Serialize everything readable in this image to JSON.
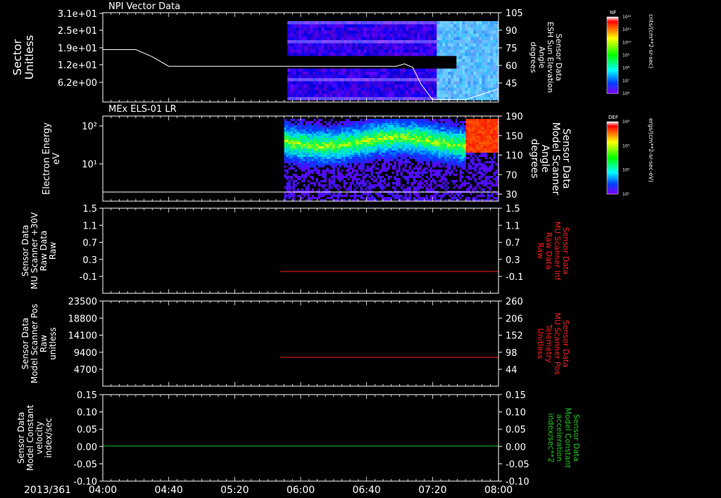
{
  "colors": {
    "background": "#000000",
    "axis": "#ffffff",
    "trace_white": "#ffffff",
    "trace_red": "#ff2020",
    "trace_green": "#20c820"
  },
  "time_axis": {
    "date_label": "2013/361",
    "ticks": [
      "04:00",
      "04:40",
      "05:20",
      "06:00",
      "06:40",
      "07:20",
      "08:00"
    ],
    "range": [
      "04:00",
      "08:00"
    ]
  },
  "colorbars": [
    {
      "label": "NF",
      "units": "cnts/(cm**2-sr-sec)",
      "ticks": [
        "10¹²",
        "10¹¹",
        "10¹⁰",
        "10⁹",
        "10⁸",
        "10⁷",
        "10⁶"
      ]
    },
    {
      "label": "DEF",
      "units": "ergs/(cm**2-sr-sec-eV)",
      "ticks": [
        "10⁴",
        "10³",
        "10²",
        "10¹"
      ]
    }
  ],
  "chart_data": [
    {
      "type": "heatmap",
      "title": "NPI Vector Data",
      "ylabel": [
        "Sector",
        "Unitless"
      ],
      "yticks_left": [
        "3.1e+01",
        "2.5e+01",
        "1.9e+01",
        "1.2e+01",
        "6.2e+00"
      ],
      "ylabel_right": [
        "Sensor Data",
        "ESH Sun Elevation",
        "Angle",
        "degrees"
      ],
      "yticks_right": [
        "105",
        "90",
        "75",
        "60",
        "45"
      ],
      "ylim_right": [
        30,
        105
      ],
      "data_start": "05:52",
      "line_series": {
        "color": "white",
        "x": [
          "04:00",
          "04:20",
          "04:30",
          "04:40",
          "05:00",
          "05:30",
          "06:00",
          "06:30",
          "06:58",
          "07:03",
          "07:08",
          "07:13",
          "07:20",
          "07:40",
          "08:00"
        ],
        "y": [
          74,
          74,
          68,
          60,
          60,
          60,
          60,
          60,
          60,
          62,
          59,
          45,
          32,
          32,
          41
        ]
      }
    },
    {
      "type": "heatmap",
      "title": "MEx ELS-01 LR",
      "ylabel": [
        "Electron Energy",
        "eV"
      ],
      "yscale": "log",
      "yticks_left": [
        "10²",
        "10¹"
      ],
      "ylabel_right": [
        "Sensor Data",
        "Model Scanner",
        "Angle",
        "degrees"
      ],
      "yticks_right": [
        "190",
        "150",
        "110",
        "70",
        "30"
      ],
      "ylim_right": [
        10,
        190
      ],
      "data_start": "05:50",
      "line_series": {
        "color": "white",
        "x": [
          "04:00",
          "08:00"
        ],
        "y": [
          17,
          17
        ]
      }
    },
    {
      "type": "line",
      "ylabel": [
        "Sensor Data",
        "MU Scanner +30V",
        "Raw Data",
        "Raw"
      ],
      "yticks_left": [
        "1.5",
        "1.1",
        "0.7",
        "0.3",
        "-0.1"
      ],
      "ylim": [
        -0.3,
        1.5
      ],
      "ylabel_right": [
        "Sensor Data",
        "MU Scanner Inf",
        "Raw Data",
        "Raw"
      ],
      "yticks_right": [
        "1.5",
        "1.1",
        "0.7",
        "0.3",
        "-0.1"
      ],
      "series": [
        {
          "color": "red",
          "x": [
            "05:47",
            "08:00"
          ],
          "y": [
            0.05,
            0.05
          ]
        }
      ]
    },
    {
      "type": "line",
      "ylabel": [
        "Sensor Data",
        "Model Scanner Pos",
        "Raw",
        "unitless"
      ],
      "yticks_left": [
        "23500",
        "18800",
        "14100",
        "9400",
        "4700"
      ],
      "ylim": [
        0,
        23500
      ],
      "ylabel_right": [
        "Sensor Data",
        "MU Scanner Pos",
        "Telemetry",
        "Unitless"
      ],
      "yticks_right": [
        "260",
        "206",
        "152",
        "98",
        "44"
      ],
      "series": [
        {
          "color": "red",
          "x": [
            "05:47",
            "08:00"
          ],
          "y": [
            8000,
            8000
          ]
        }
      ]
    },
    {
      "type": "line",
      "ylabel": [
        "Sensor Data",
        "Model Constant",
        "velocity",
        "index/sec"
      ],
      "yticks_left": [
        "0.15",
        "0.10",
        "0.05",
        "0.00",
        "-0.05",
        "-0.10"
      ],
      "ylim": [
        -0.1,
        0.15
      ],
      "ylabel_right": [
        "Sensor Data",
        "Model Constant",
        "acceleration",
        "index/sec**2"
      ],
      "yticks_right": [
        "0.15",
        "0.10",
        "0.05",
        "0.00",
        "-0.05",
        "-0.10"
      ],
      "series": [
        {
          "color": "green",
          "x": [
            "04:00",
            "08:00"
          ],
          "y": [
            0.0,
            0.0
          ]
        }
      ]
    }
  ]
}
